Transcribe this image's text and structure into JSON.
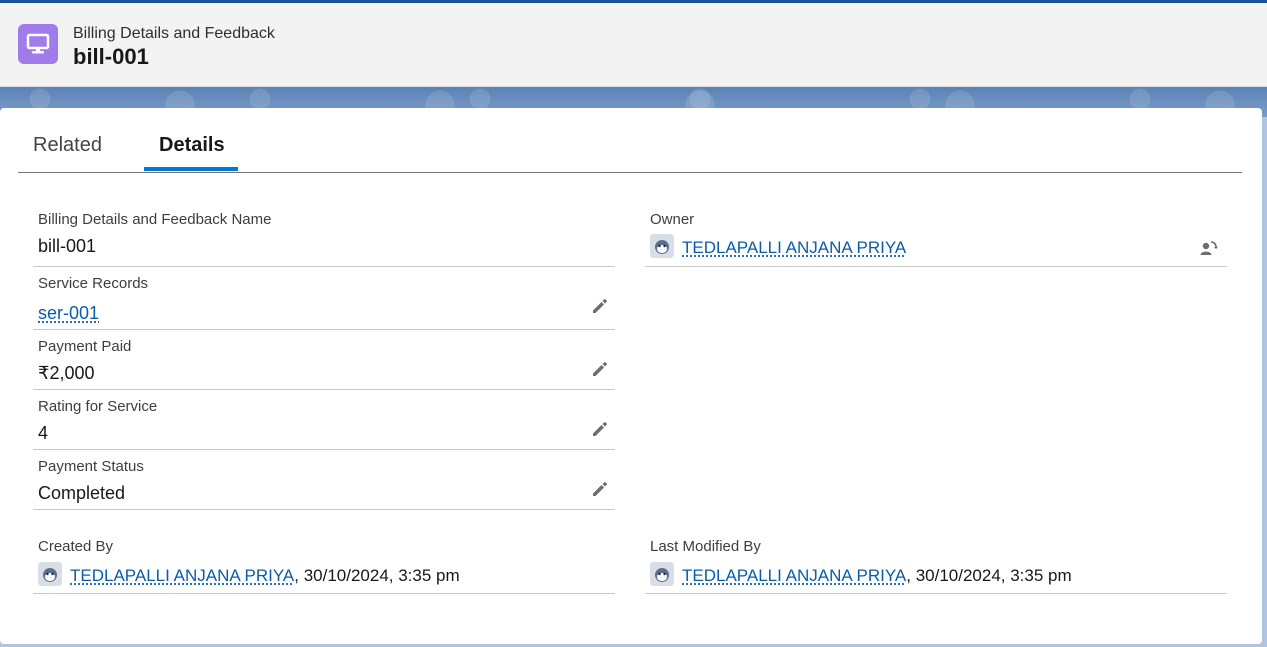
{
  "header": {
    "object_label": "Billing Details and Feedback",
    "record_title": "bill-001",
    "icon": "desktop-icon",
    "accent": "#9f7ce9"
  },
  "tabs": [
    {
      "label": "Related",
      "active": false
    },
    {
      "label": "Details",
      "active": true
    }
  ],
  "fields": {
    "name": {
      "label": "Billing Details and Feedback Name",
      "value": "bill-001"
    },
    "owner": {
      "label": "Owner",
      "value": "TEDLAPALLI ANJANA PRIYA"
    },
    "service_records": {
      "label": "Service Records",
      "value": "ser-001"
    },
    "payment_paid": {
      "label": "Payment Paid",
      "value": "₹2,000"
    },
    "rating": {
      "label": "Rating for Service",
      "value": "4"
    },
    "payment_status": {
      "label": "Payment Status",
      "value": "Completed"
    },
    "created_by": {
      "label": "Created By",
      "user": "TEDLAPALLI ANJANA PRIYA",
      "date": ", 30/10/2024, 3:35 pm"
    },
    "last_modified_by": {
      "label": "Last Modified By",
      "user": "TEDLAPALLI ANJANA PRIYA",
      "date": ", 30/10/2024, 3:35 pm"
    }
  },
  "colors": {
    "link": "#0b5cab",
    "active_tab": "#0176d3"
  }
}
